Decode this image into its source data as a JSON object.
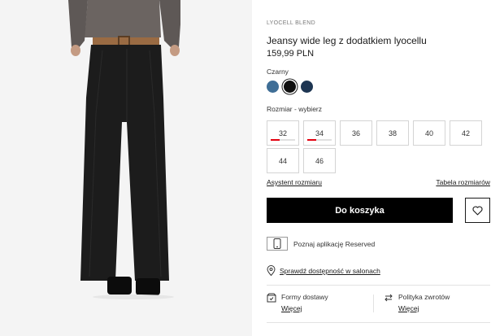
{
  "product": {
    "collection": "LYOCELL BLEND",
    "title": "Jeansy wide leg z dodatkiem lyocellu",
    "price": "159,99 PLN"
  },
  "colors": {
    "label": "Czarny",
    "options": [
      {
        "name": "blue-denim",
        "hex": "#3f6e96",
        "selected": false
      },
      {
        "name": "black",
        "hex": "#111111",
        "selected": true
      },
      {
        "name": "navy",
        "hex": "#1d3552",
        "selected": false
      }
    ]
  },
  "sizes": {
    "label": "Rozmiar -  wybierz",
    "options": [
      {
        "label": "32",
        "low_stock": true
      },
      {
        "label": "34",
        "low_stock": true
      },
      {
        "label": "36",
        "low_stock": false
      },
      {
        "label": "38",
        "low_stock": false
      },
      {
        "label": "40",
        "low_stock": false
      },
      {
        "label": "42",
        "low_stock": false
      },
      {
        "label": "44",
        "low_stock": false
      },
      {
        "label": "46",
        "low_stock": false
      }
    ]
  },
  "links": {
    "size_assistant": "Asystent rozmiaru",
    "size_table": "Tabela rozmiarów"
  },
  "actions": {
    "add_to_cart": "Do koszyka"
  },
  "app_promo": "Poznaj aplikację Reserved",
  "store_check": "Sprawdź dostępność w salonach",
  "delivery": {
    "title": "Formy dostawy",
    "link": "Więcej"
  },
  "returns": {
    "title": "Polityka zwrotów",
    "link": "Więcej"
  }
}
